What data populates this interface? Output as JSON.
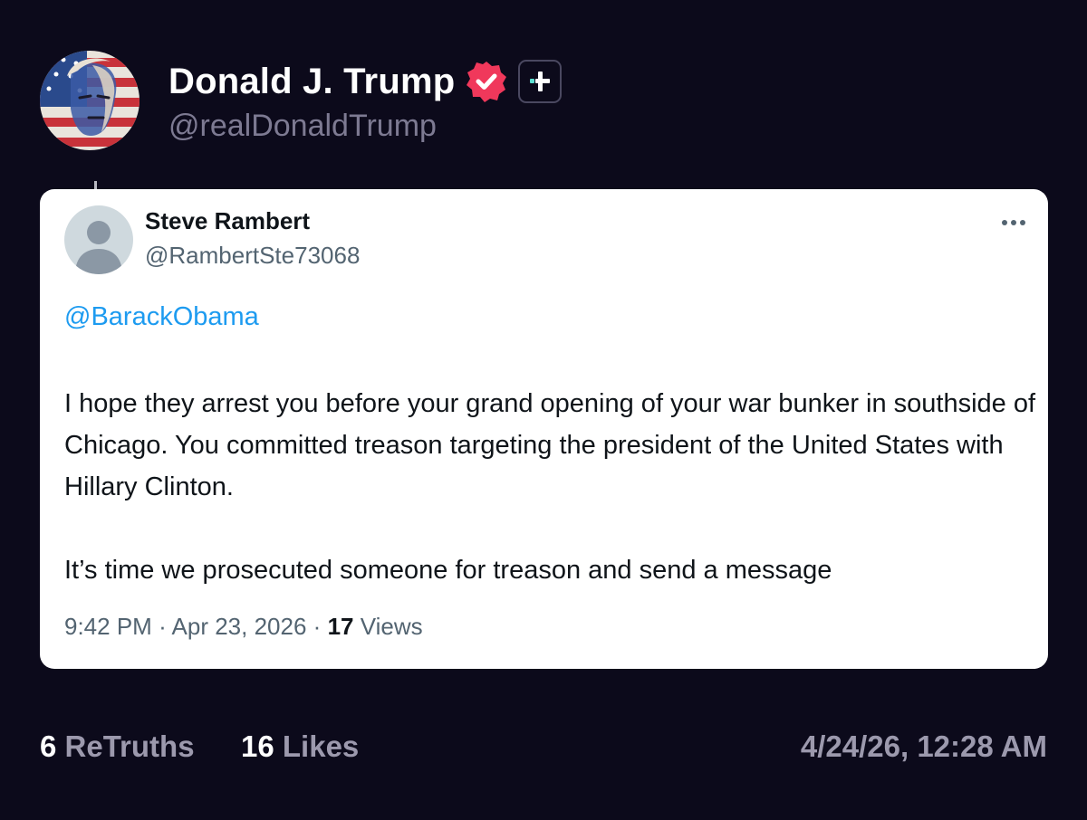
{
  "post": {
    "author": {
      "display_name": "Donald J. Trump",
      "handle": "@realDonaldTrump",
      "verified_icon": "verified-badge-icon",
      "badge_icon": "plus-badge-icon"
    },
    "stats": {
      "retruths_count": "6",
      "retruths_label": "ReTruths",
      "likes_count": "16",
      "likes_label": "Likes"
    },
    "timestamp": "4/24/26, 12:28 AM"
  },
  "quoted_tweet": {
    "author_name": "Steve Rambert",
    "author_handle": "@RambertSte73068",
    "mention": "@BarackObama",
    "paragraphs": [
      "I hope they arrest you before your grand opening of your war bunker in southside of Chicago. You committed treason targeting the president of the United States with Hillary Clinton.",
      "It’s time we prosecuted someone for treason and send a message"
    ],
    "time": "9:42 PM",
    "separator": "·",
    "date": "Apr 23, 2026",
    "views_count": "17",
    "views_label": "Views"
  },
  "colors": {
    "background": "#0c0a1b",
    "verified_badge": "#f0385b",
    "plus_badge_accent": "#5de0d2",
    "mention_link": "#1d9bf0"
  }
}
